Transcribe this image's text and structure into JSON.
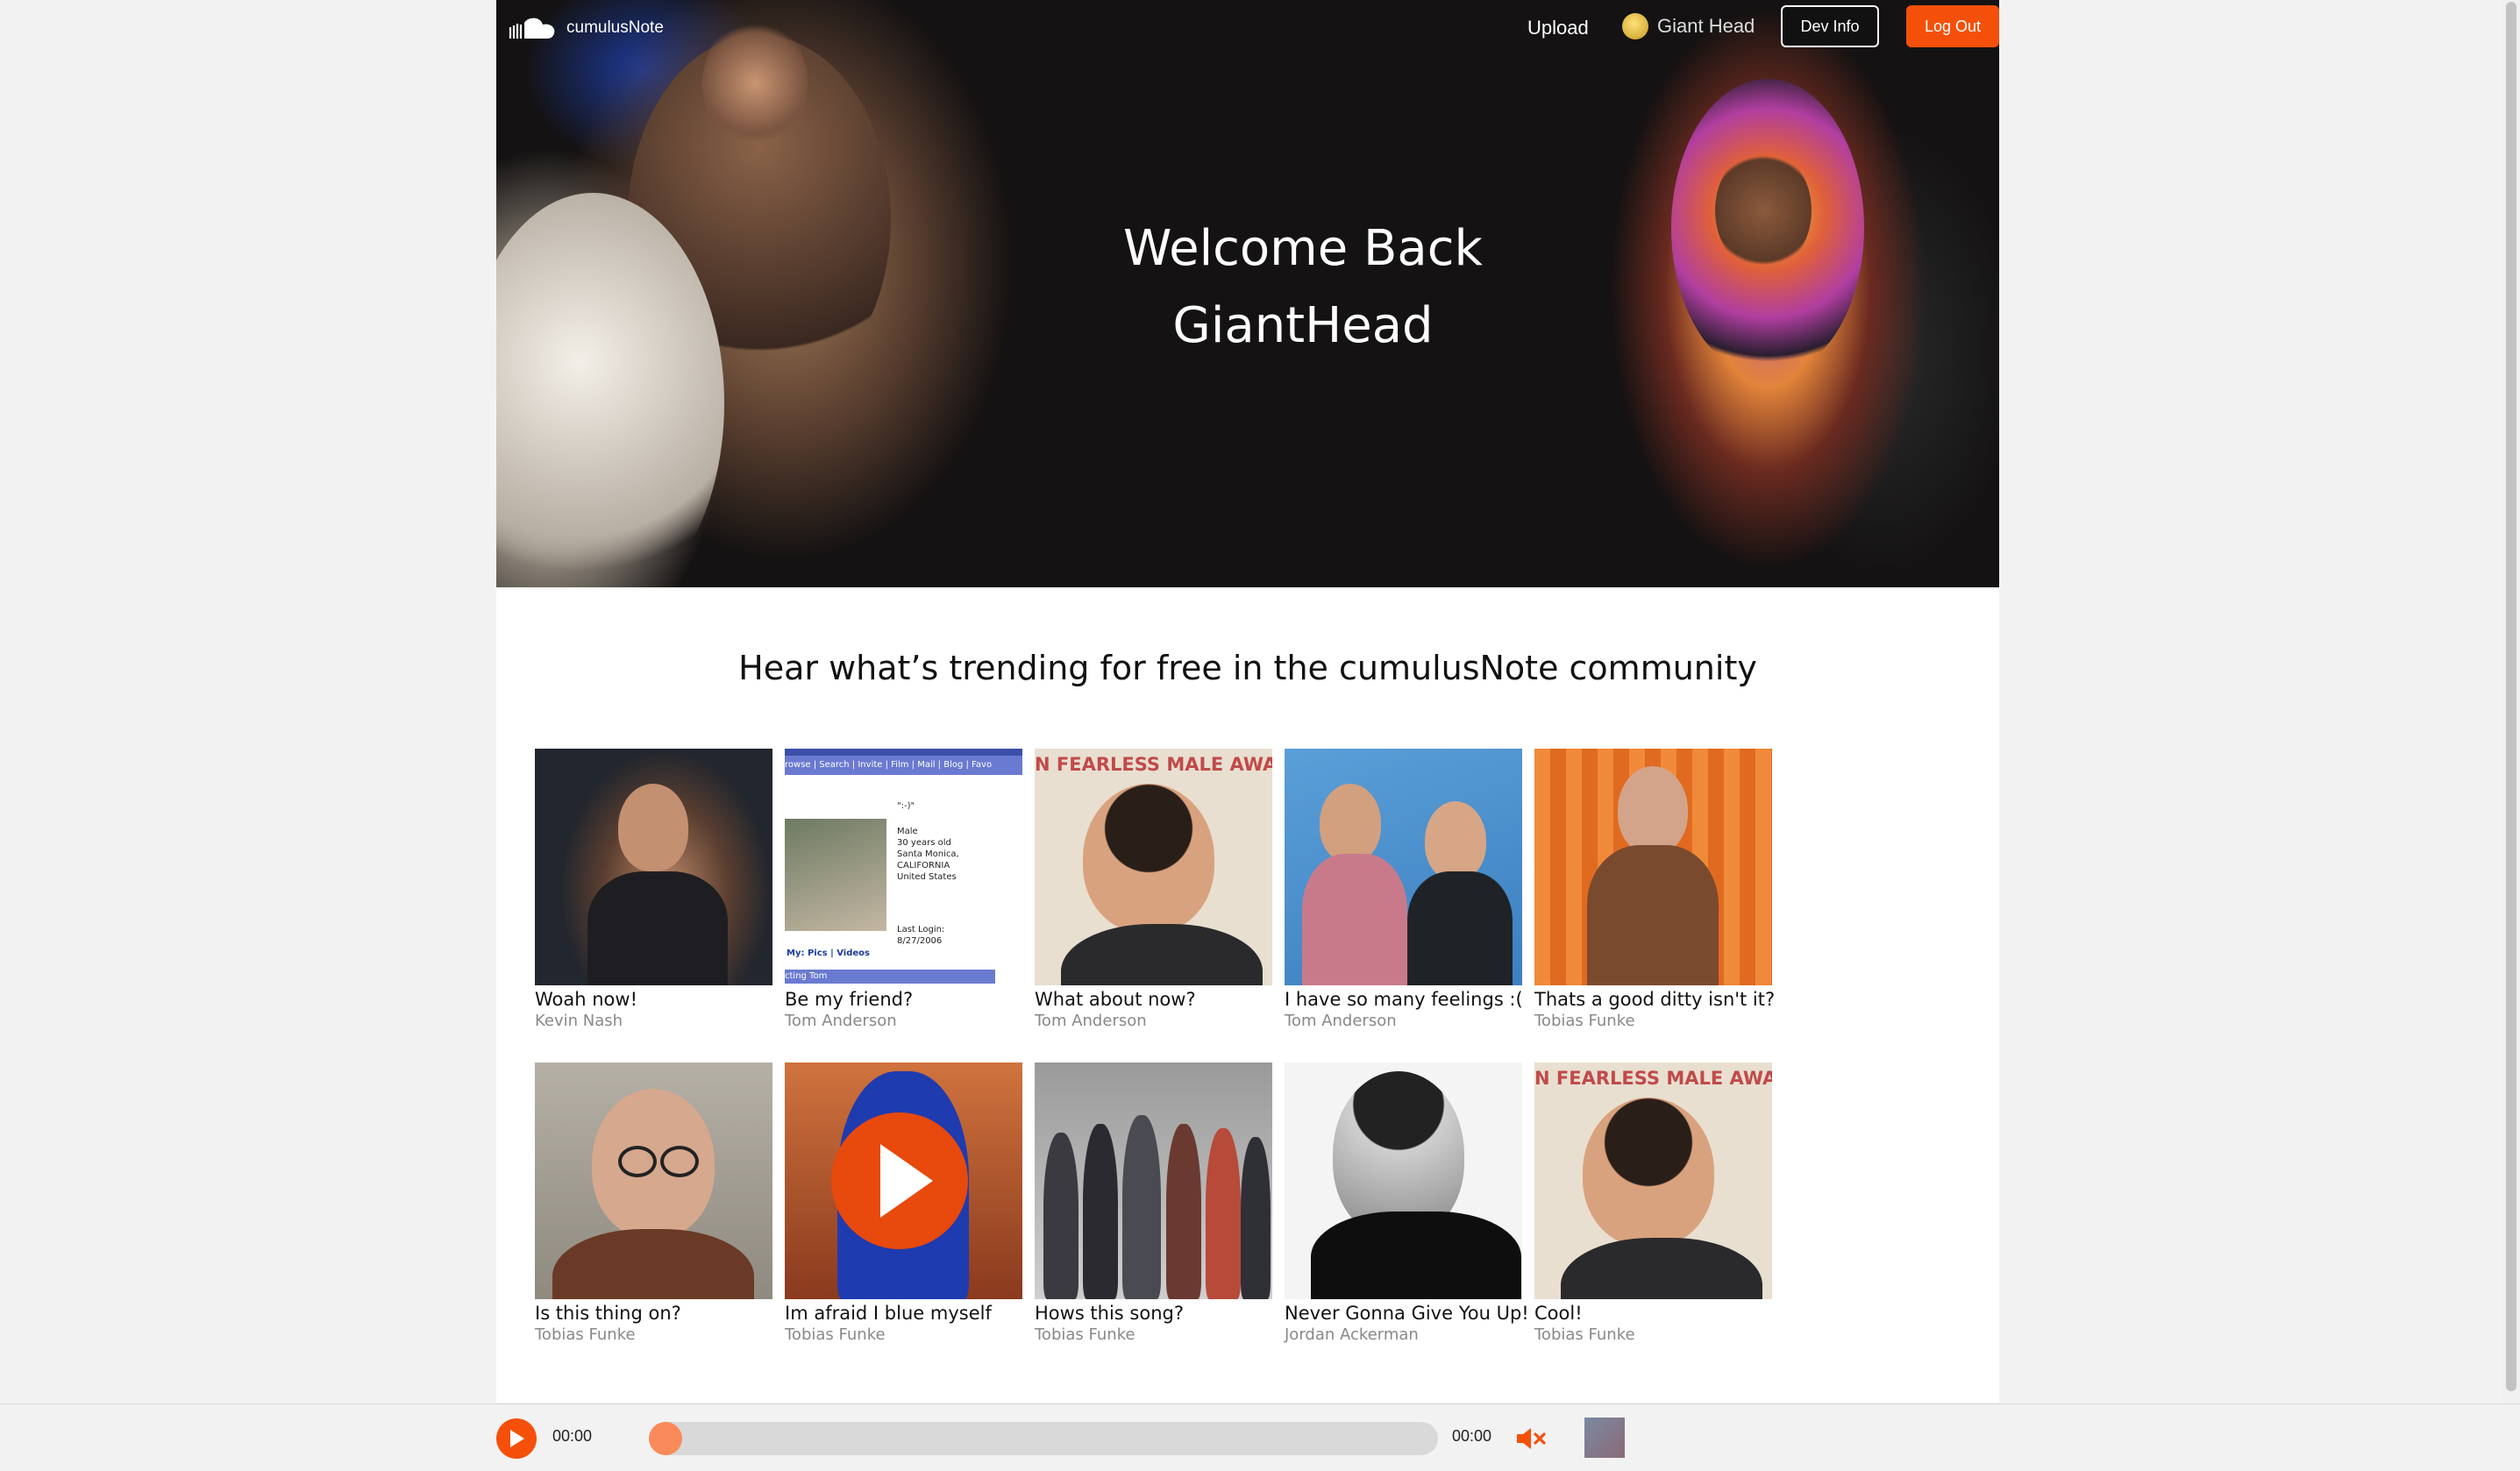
{
  "brand": {
    "name": "cumulusNote",
    "logo_icon": "cloud-icon"
  },
  "nav": {
    "upload": "Upload",
    "username": "Giant Head",
    "dev_info": "Dev Info",
    "logout": "Log Out"
  },
  "hero": {
    "line1": "Welcome Back",
    "line2": "GiantHead"
  },
  "trending": {
    "heading": "Hear what’s trending for free in the cumulusNote community",
    "tracks": [
      {
        "title": "Woah now!",
        "artist": "Kevin Nash"
      },
      {
        "title": "Be my friend?",
        "artist": "Tom Anderson"
      },
      {
        "title": "What about now?",
        "artist": "Tom Anderson"
      },
      {
        "title": "I have so many feelings :(",
        "artist": "Tom Anderson"
      },
      {
        "title": "Thats a good ditty isn't it?",
        "artist": "Tobias Funke"
      },
      {
        "title": "Is this thing on?",
        "artist": "Tobias Funke"
      },
      {
        "title": "Im afraid I blue myself",
        "artist": "Tobias Funke"
      },
      {
        "title": "Hows this song?",
        "artist": "Tobias Funke"
      },
      {
        "title": "Never Gonna Give You Up!",
        "artist": "Jordan Ackerman"
      },
      {
        "title": "Cool!",
        "artist": "Tobias Funke"
      }
    ],
    "thumb_texts": {
      "awards": "N FEARLESS MALE AWARDS",
      "myspace_nav": "rowse | Search | Invite | Film | Mail | Blog | Favo",
      "myspace_profile": "Male\n30 years old\nSanta Monica,\nCALIFORNIA\nUnited States",
      "myspace_login": "Last Login:\n8/27/2006",
      "myspace_links": "My: Pics | Videos",
      "myspace_bar": "cting Tom",
      "myspace_quote": "\":-)\""
    }
  },
  "player": {
    "current_time": "00:00",
    "duration": "00:00",
    "progress": 0,
    "accent": "#f5500a",
    "icons": [
      "play-icon",
      "mute-icon"
    ]
  }
}
